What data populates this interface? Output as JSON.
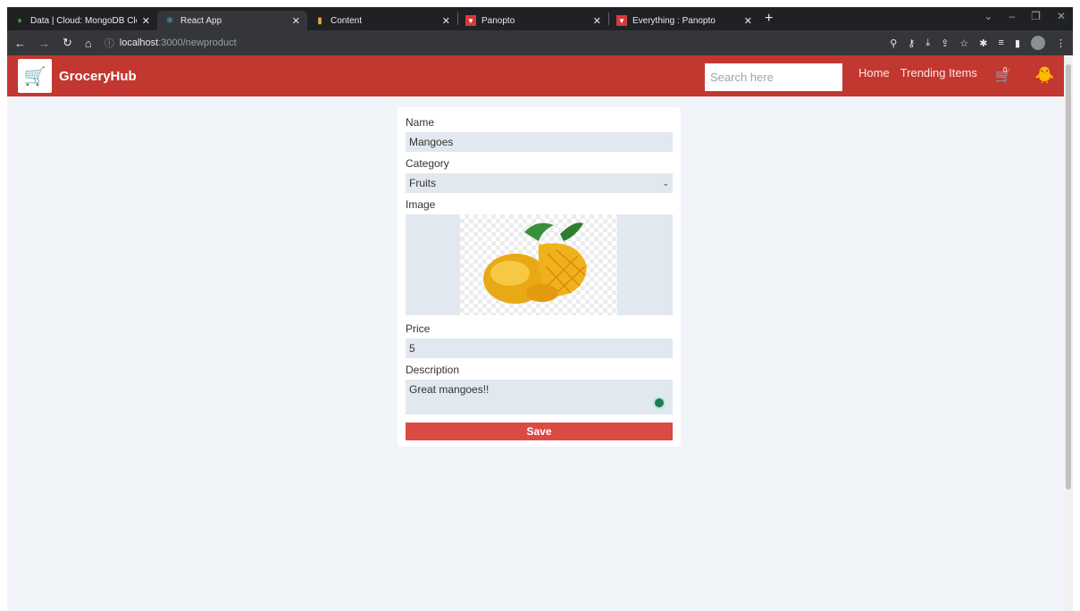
{
  "browser": {
    "tabs": [
      {
        "title": "Data | Cloud: MongoDB Cloud",
        "icon": "mongodb-leaf-icon",
        "active": false
      },
      {
        "title": "React App",
        "icon": "react-icon",
        "active": true
      },
      {
        "title": "Content",
        "icon": "bar-chart-icon",
        "active": false
      },
      {
        "title": "Panopto",
        "icon": "panopto-icon",
        "active": false
      },
      {
        "title": "Everything : Panopto",
        "icon": "panopto-icon",
        "active": false
      }
    ],
    "url_host": "localhost",
    "url_path": ":3000/newproduct"
  },
  "header": {
    "brand": "GroceryHub",
    "search_placeholder": "Search here",
    "nav": [
      "Home",
      "Trending Items"
    ],
    "cart_count": "0"
  },
  "form": {
    "name_label": "Name",
    "name_value": "Mangoes",
    "category_label": "Category",
    "category_value": "Fruits",
    "image_label": "Image",
    "price_label": "Price",
    "price_value": "5",
    "description_label": "Description",
    "description_value": "Great mangoes!!",
    "save_label": "Save"
  },
  "colors": {
    "header_bg": "#c2372f",
    "save_bg": "#db4a43",
    "page_bg": "#f1f5f9",
    "field_bg": "#e2e8f0"
  }
}
